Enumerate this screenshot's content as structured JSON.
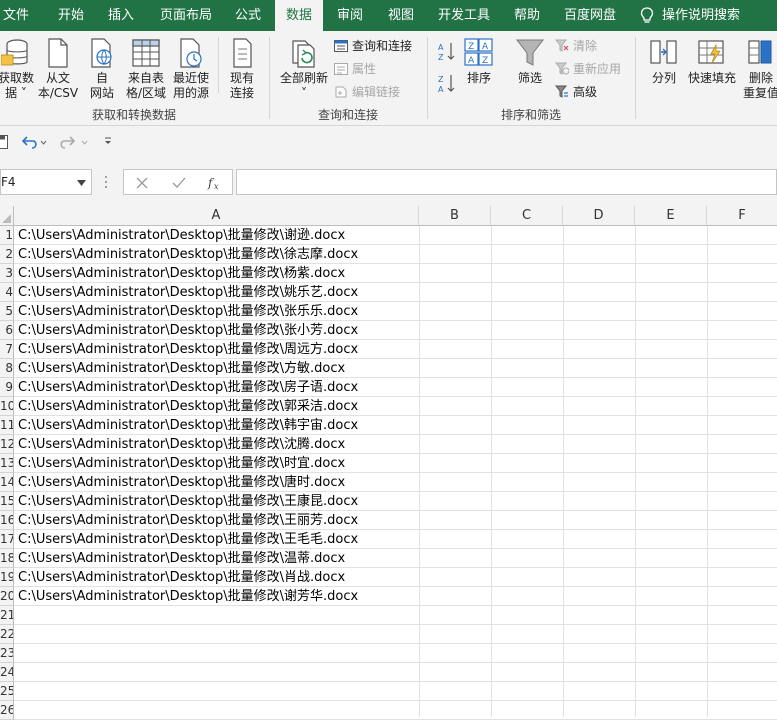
{
  "tabs": [
    "文件",
    "开始",
    "插入",
    "页面布局",
    "公式",
    "数据",
    "审阅",
    "视图",
    "开发工具",
    "帮助",
    "百度网盘"
  ],
  "active_tab": "数据",
  "tell_me": "操作说明搜索",
  "ribbon": {
    "get_data": {
      "line1": "获取数",
      "line2": "据 ˅"
    },
    "from_text": {
      "line1": "从文",
      "line2": "本/CSV"
    },
    "from_web": {
      "line1": "自",
      "line2": "网站"
    },
    "from_table": {
      "line1": "来自表",
      "line2": "格/区域"
    },
    "recent_sources": {
      "line1": "最近使",
      "line2": "用的源"
    },
    "existing_conn": {
      "line1": "现有",
      "line2": "连接"
    },
    "group_get_transform": "获取和转换数据",
    "refresh_all": {
      "line1": "全部刷新",
      "line2": "˅"
    },
    "queries_conn": "查询和连接",
    "properties": "属性",
    "edit_links": "编辑链接",
    "group_queries": "查询和连接",
    "sort": "排序",
    "filter": "筛选",
    "clear": "清除",
    "reapply": "重新应用",
    "advanced": "高级",
    "group_sort_filter": "排序和筛选",
    "text_to_columns": "分列",
    "flash_fill": "快速填充",
    "remove_dup": {
      "line1": "删除",
      "line2": "重复值"
    }
  },
  "namebox": "F4",
  "columns": [
    "A",
    "B",
    "C",
    "D",
    "E",
    "F"
  ],
  "rows": [
    "1",
    "2",
    "3",
    "4",
    "5",
    "6",
    "7",
    "8",
    "9",
    "10",
    "11",
    "12",
    "13",
    "14",
    "15",
    "16",
    "17",
    "18",
    "19",
    "20",
    "21",
    "22",
    "23",
    "24",
    "25",
    "26"
  ],
  "cells": [
    "C:\\Users\\Administrator\\Desktop\\批量修改\\谢逊.docx",
    "C:\\Users\\Administrator\\Desktop\\批量修改\\徐志摩.docx",
    "C:\\Users\\Administrator\\Desktop\\批量修改\\杨紫.docx",
    "C:\\Users\\Administrator\\Desktop\\批量修改\\姚乐艺.docx",
    "C:\\Users\\Administrator\\Desktop\\批量修改\\张乐乐.docx",
    "C:\\Users\\Administrator\\Desktop\\批量修改\\张小芳.docx",
    "C:\\Users\\Administrator\\Desktop\\批量修改\\周远方.docx",
    "C:\\Users\\Administrator\\Desktop\\批量修改\\方敏.docx",
    "C:\\Users\\Administrator\\Desktop\\批量修改\\房子语.docx",
    "C:\\Users\\Administrator\\Desktop\\批量修改\\郭采洁.docx",
    "C:\\Users\\Administrator\\Desktop\\批量修改\\韩宇宙.docx",
    "C:\\Users\\Administrator\\Desktop\\批量修改\\沈腾.docx",
    "C:\\Users\\Administrator\\Desktop\\批量修改\\时宜.docx",
    "C:\\Users\\Administrator\\Desktop\\批量修改\\唐时.docx",
    "C:\\Users\\Administrator\\Desktop\\批量修改\\王康昆.docx",
    "C:\\Users\\Administrator\\Desktop\\批量修改\\王丽芳.docx",
    "C:\\Users\\Administrator\\Desktop\\批量修改\\王毛毛.docx",
    "C:\\Users\\Administrator\\Desktop\\批量修改\\温蒂.docx",
    "C:\\Users\\Administrator\\Desktop\\批量修改\\肖战.docx",
    "C:\\Users\\Administrator\\Desktop\\批量修改\\谢芳华.docx"
  ],
  "colors": {
    "accent": "#217346",
    "ribbon_bg": "#f3f3f3",
    "grid_line": "#e1e1e1"
  },
  "icons": {
    "tell_me": "lightbulb-icon",
    "save": "save-icon",
    "undo": "undo-icon",
    "redo": "redo-icon",
    "cancel": "x-icon",
    "enter": "check-icon",
    "function": "fx-icon"
  }
}
